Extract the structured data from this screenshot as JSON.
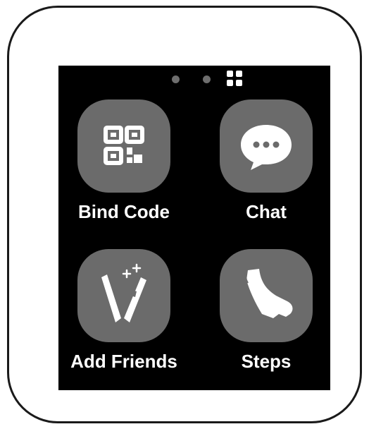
{
  "pager": {
    "pages": 3,
    "current_page": 3,
    "icons": [
      "dot-icon",
      "dot-icon",
      "grid-icon"
    ]
  },
  "apps": [
    {
      "label": "Bind Code",
      "icon": "qr-code-icon"
    },
    {
      "label": "Chat",
      "icon": "chat-bubble-icon"
    },
    {
      "label": "Add Friends",
      "icon": "add-friends-bracelets-icon"
    },
    {
      "label": "Steps",
      "icon": "shoe-icon"
    }
  ],
  "colors": {
    "screen_background": "#000000",
    "tile_background": "#6b6b6b",
    "icon_foreground": "#ffffff",
    "label_text": "#ffffff",
    "inactive_dot": "#6e6e6e"
  }
}
